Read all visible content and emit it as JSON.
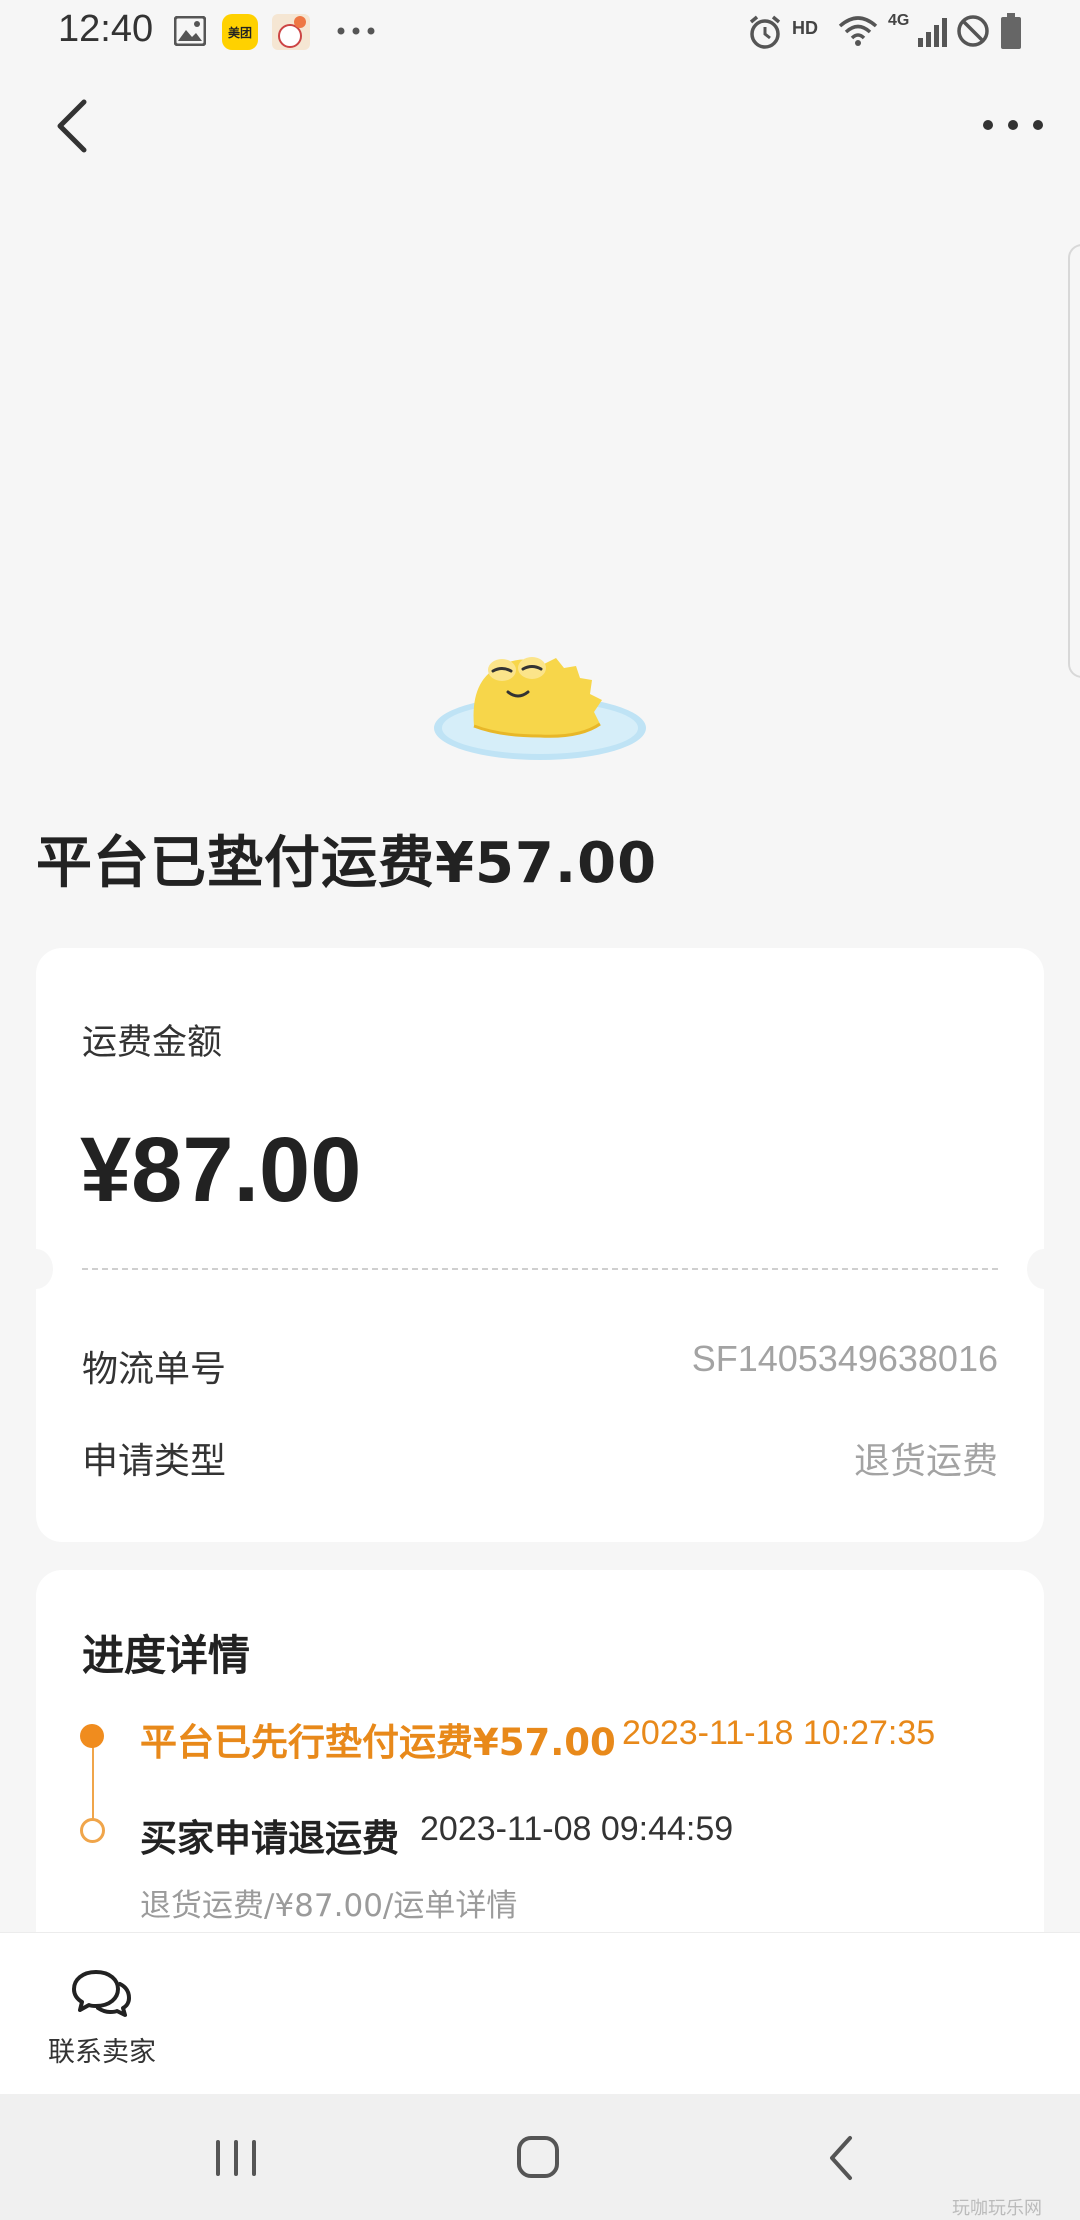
{
  "status_bar": {
    "time": "12:40",
    "hd_label": "HD",
    "network_label": "4G",
    "meituan_label": "美团",
    "icons": [
      "gallery-icon",
      "meituan-app-icon",
      "app-notification-icon",
      "more-notifications-icon",
      "alarm-icon",
      "wifi-icon",
      "signal-icon",
      "do-not-disturb-icon",
      "battery-icon"
    ]
  },
  "nav": {
    "back_icon": "chevron-left-icon",
    "more_icon": "more-horizontal-icon"
  },
  "headline": "平台已垫付运费¥57.00",
  "fee_card": {
    "amount_label": "运费金额",
    "amount_value": "¥87.00",
    "rows": [
      {
        "label": "物流单号",
        "value": "SF1405349638016"
      },
      {
        "label": "申请类型",
        "value": "退货运费"
      }
    ]
  },
  "progress": {
    "title": "进度详情",
    "steps": [
      {
        "title": "平台已先行垫付运费¥57.00",
        "time": "2023-11-18 10:27:35",
        "detail": ""
      },
      {
        "title": "买家申请退运费",
        "time": "2023-11-08 09:44:59",
        "detail": "退货运费/¥87.00/运单详情"
      }
    ]
  },
  "bottom_bar": {
    "contact_label": "联系卖家",
    "contact_icon": "chat-bubbles-icon"
  },
  "system_nav": {
    "recents_icon": "recents-icon",
    "home_icon": "home-icon",
    "back_icon": "system-back-icon"
  },
  "watermark": "玩咖玩乐网",
  "colors": {
    "accent": "#e8891a",
    "background": "#f6f6f6",
    "card": "#ffffff"
  }
}
